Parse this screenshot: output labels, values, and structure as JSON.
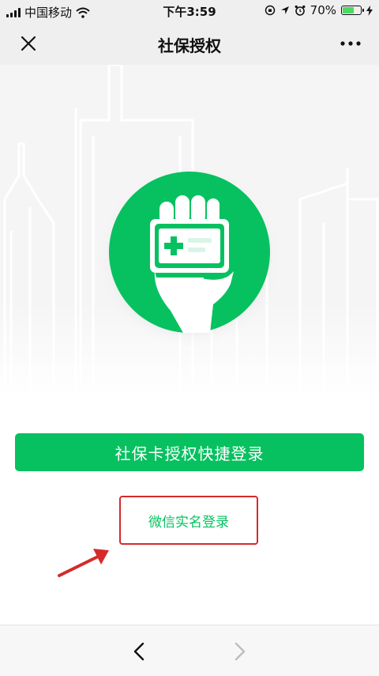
{
  "status_bar": {
    "carrier": "中国移动",
    "time": "下午3:59",
    "battery_percent": "70%",
    "battery_level": 0.7,
    "icons": [
      "signal-icon",
      "wifi-icon",
      "orientation-lock-icon",
      "location-icon",
      "alarm-icon",
      "battery-icon",
      "charging-icon"
    ]
  },
  "nav": {
    "title": "社保授权",
    "close_icon": "close-icon",
    "more_icon": "more-icon"
  },
  "hero": {
    "icon": "hand-holding-social-security-card-icon",
    "background": "city-skyline-outline",
    "accent_color": "#07c160"
  },
  "primary_button": {
    "label": "社保卡授权快捷登录",
    "color": "#07c160"
  },
  "secondary_link": {
    "label": "微信实名登录",
    "highlight_color": "#d52a2a"
  },
  "bottom_bar": {
    "back_icon": "chevron-left-icon",
    "forward_icon": "chevron-right-icon",
    "forward_enabled": false
  }
}
